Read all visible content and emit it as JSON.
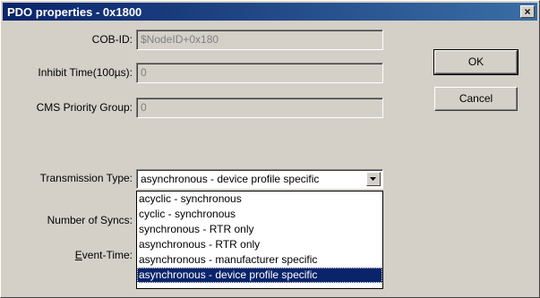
{
  "window": {
    "title": "PDO properties - 0x1800",
    "close_label": "×"
  },
  "form": {
    "cob_id": {
      "label": "COB-ID:",
      "value": "$NodeID+0x180"
    },
    "inhibit_time": {
      "label": "Inhibit Time(100µs):",
      "value": "0"
    },
    "cms_priority": {
      "label": "CMS Priority Group:",
      "value": "0"
    },
    "transmission_type": {
      "label": "Transmission Type:",
      "value": "asynchronous - device profile specific"
    },
    "num_syncs": {
      "label": "Number of Syncs:"
    },
    "event_time": {
      "label_mnemonic": "E",
      "label_rest": "vent-Time:"
    }
  },
  "dropdown": {
    "options": [
      "acyclic - synchronous",
      "cyclic - synchronous",
      "synchronous - RTR only",
      "asynchronous - RTR only",
      "asynchronous - manufacturer specific",
      "asynchronous - device profile specific"
    ],
    "selected_index": 5
  },
  "buttons": {
    "ok": "OK",
    "cancel": "Cancel"
  },
  "icons": {
    "close": "close-icon",
    "dropdown_arrow": "chevron-down-icon"
  }
}
